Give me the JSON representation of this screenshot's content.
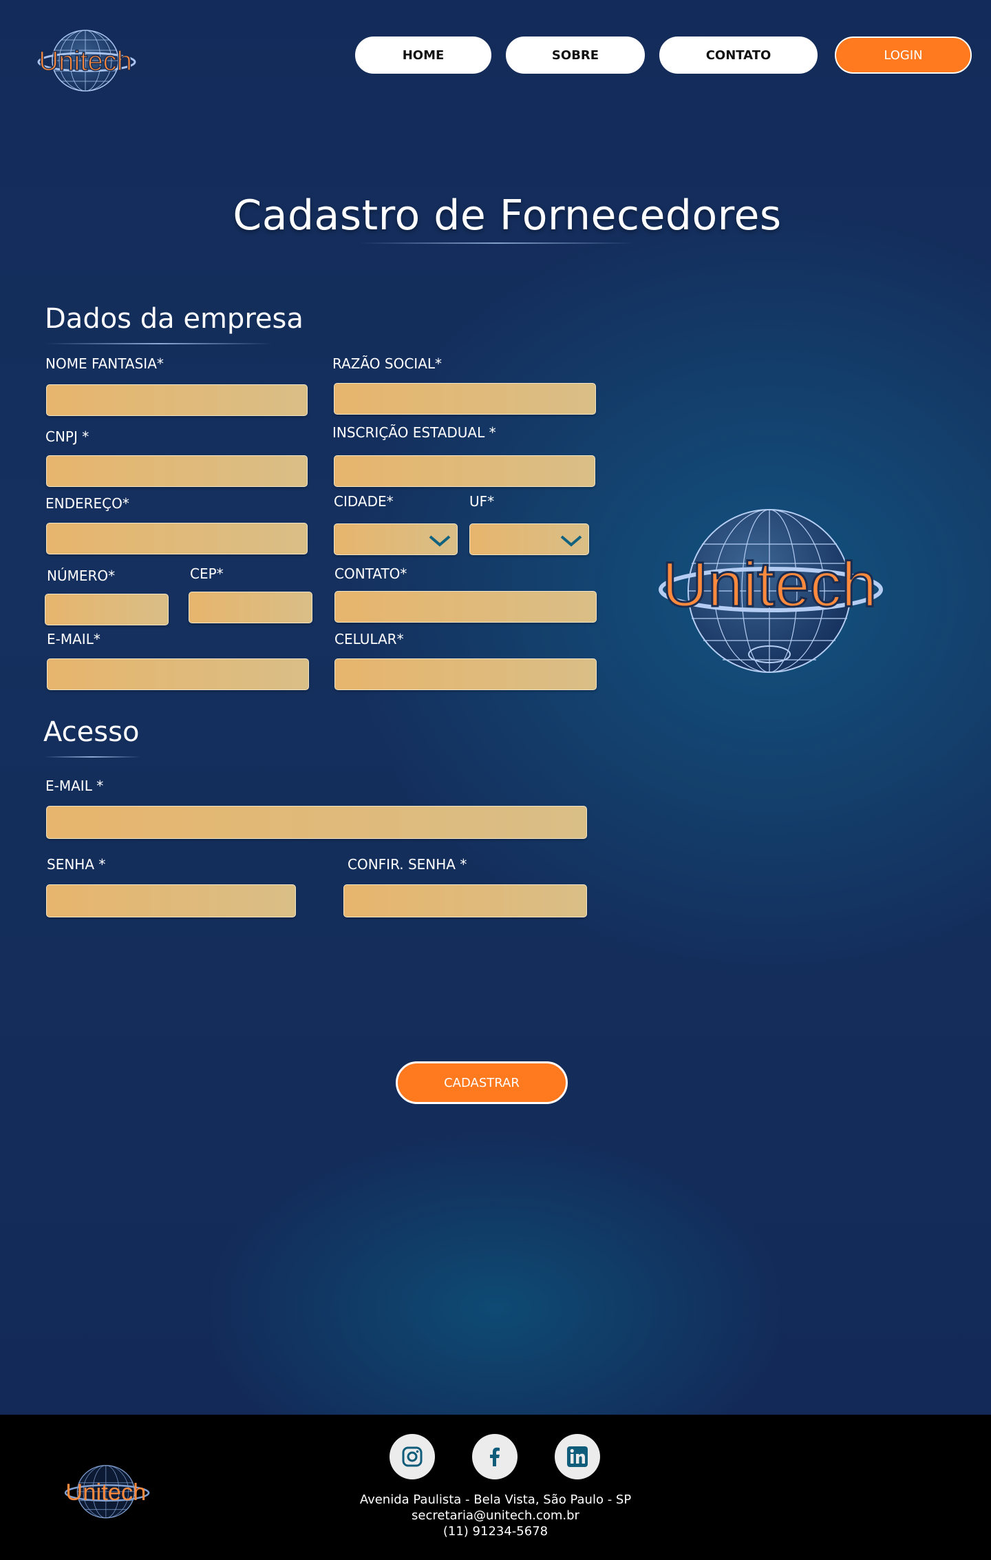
{
  "brand": {
    "logo_text": "Unitech",
    "accent": "#ff7a1f",
    "navy": "#132b5a"
  },
  "nav": {
    "home": "HOME",
    "sobre": "SOBRE",
    "contato": "CONTATO",
    "login": "LOGIN"
  },
  "title": "Cadastro de Fornecedores",
  "empresa": {
    "heading": "Dados da empresa",
    "nome_fantasia": "NOME FANTASIA*",
    "razao_social": "RAZÃO SOCIAL*",
    "cnpj": "CNPJ *",
    "inscricao_estadual": "INSCRIÇÃO ESTADUAL *",
    "endereco": "ENDEREÇO*",
    "cidade": "CIDADE*",
    "uf": "UF*",
    "numero": "NÚMERO*",
    "cep": "CEP*",
    "contato": "CONTATO*",
    "email": "E-MAIL*",
    "celular": "CELULAR*"
  },
  "acesso": {
    "heading": "Acesso",
    "email": "E-MAIL *",
    "senha": "SENHA *",
    "confir_senha": "CONFIR. SENHA *"
  },
  "submit_label": "CADASTRAR",
  "footer": {
    "address": "Avenida Paulista - Bela Vista, São Paulo - SP",
    "email": "secretaria@unitech.com.br",
    "phone": "(11) 91234-5678",
    "social_icons": [
      "instagram-icon",
      "facebook-icon",
      "linkedin-icon"
    ]
  }
}
